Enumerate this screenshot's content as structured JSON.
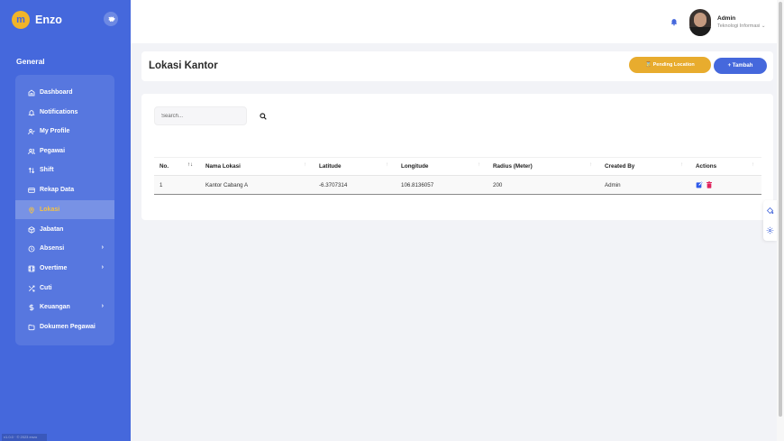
{
  "brand": {
    "logo": "m",
    "name": "Enzo"
  },
  "sidebar": {
    "section": "General",
    "items": [
      {
        "label": "Dashboard",
        "icon": "home-icon"
      },
      {
        "label": "Notifications",
        "icon": "bell-icon"
      },
      {
        "label": "My Profile",
        "icon": "user-check-icon"
      },
      {
        "label": "Pegawai",
        "icon": "users-icon"
      },
      {
        "label": "Shift",
        "icon": "swap-icon"
      },
      {
        "label": "Rekap Data",
        "icon": "card-icon"
      },
      {
        "label": "Lokasi",
        "icon": "map-pin-icon",
        "active": true
      },
      {
        "label": "Jabatan",
        "icon": "box-icon"
      },
      {
        "label": "Absensi",
        "icon": "clock-icon",
        "chevron": "›"
      },
      {
        "label": "Overtime",
        "icon": "film-icon",
        "chevron": "›"
      },
      {
        "label": "Cuti",
        "icon": "shuffle-icon"
      },
      {
        "label": "Keuangan",
        "icon": "dollar-icon",
        "chevron": "›"
      },
      {
        "label": "Dokumen Pegawai",
        "icon": "folder-icon"
      }
    ],
    "version": "v1.0.0 · © 2023 enzo"
  },
  "header": {
    "user_name": "Admin",
    "user_role": "Teknologi Informasi",
    "role_chevron": "⌄"
  },
  "page": {
    "title": "Lokasi Kantor",
    "pending_button": "⌛  Pending Location",
    "add_button": "+ Tambah"
  },
  "search": {
    "placeholder": "Search..."
  },
  "table": {
    "columns": [
      "No.",
      "Nama Lokasi",
      "Latitude",
      "Longitude",
      "Radius (Meter)",
      "Created By",
      "Actions"
    ],
    "sort_glyphs": [
      "↑↓",
      "↑",
      "↑",
      "↑",
      "↑",
      "↑",
      "↑"
    ],
    "rows": [
      {
        "no": "1",
        "nama": "Kantor Cabang A",
        "lat": "-6.3707314",
        "lng": "106.8136057",
        "radius": "200",
        "created_by": "Admin"
      }
    ]
  },
  "colors": {
    "primary": "#4568dc",
    "accent": "#f5c243",
    "pending": "#e8ac2e",
    "edit": "#2f5bea",
    "delete": "#e0245e"
  }
}
